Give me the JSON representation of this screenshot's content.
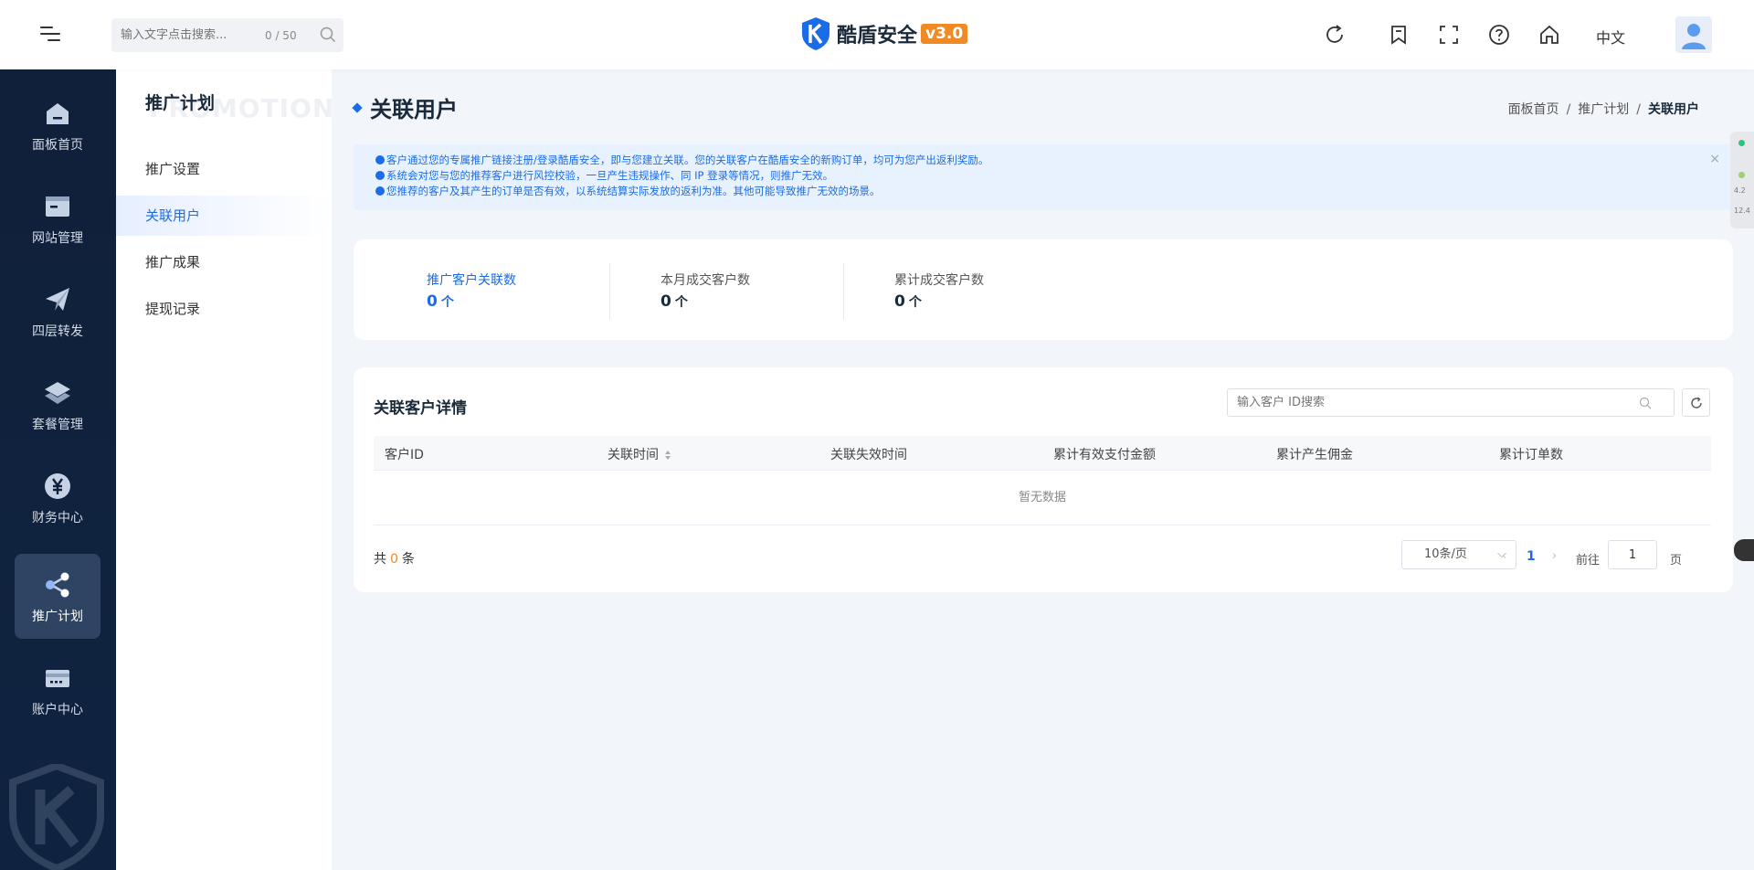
{
  "header": {
    "search_placeholder": "输入文字点击搜索...",
    "search_counter": "0 / 50",
    "brand_name": "酷盾安全",
    "brand_version": "v3.0",
    "language": "中文"
  },
  "sidebar": {
    "items": [
      {
        "label": "面板首页",
        "icon": "house-icon"
      },
      {
        "label": "网站管理",
        "icon": "browser-icon"
      },
      {
        "label": "四层转发",
        "icon": "paper-plane-icon"
      },
      {
        "label": "套餐管理",
        "icon": "layers-icon"
      },
      {
        "label": "财务中心",
        "icon": "yuan-icon"
      },
      {
        "label": "推广计划",
        "icon": "share-icon"
      },
      {
        "label": "账户中心",
        "icon": "wallet-icon"
      }
    ],
    "active_index": 5
  },
  "submenu": {
    "title": "推广计划",
    "watermark": "PROMOTION",
    "items": [
      "推广设置",
      "关联用户",
      "推广成果",
      "提现记录"
    ],
    "active_index": 1
  },
  "page": {
    "title": "关联用户",
    "breadcrumb": [
      "面板首页",
      "推广计划",
      "关联用户"
    ],
    "breadcrumb_sep": "/"
  },
  "alert": {
    "lines": [
      "客户通过您的专属推广链接注册/登录酷盾安全，即与您建立关联。您的关联客户在酷盾安全的新购订单，均可为您产出返利奖励。",
      "系统会对您与您的推荐客户进行风控校验，一旦产生违规操作、同 IP 登录等情况，则推广无效。",
      "您推荐的客户及其产生的订单是否有效，以系统结算实际发放的返利为准。其他可能导致推广无效的场景。"
    ],
    "close_symbol": "×"
  },
  "stats": [
    {
      "label": "推广客户关联数",
      "value": "0",
      "unit": "个"
    },
    {
      "label": "本月成交客户数",
      "value": "0",
      "unit": "个"
    },
    {
      "label": "累计成交客户数",
      "value": "0",
      "unit": "个"
    }
  ],
  "table": {
    "title": "关联客户详情",
    "search_placeholder": "输入客户 ID搜索",
    "columns": [
      "客户ID",
      "关联时间",
      "关联失效时间",
      "累计有效支付金额",
      "累计产生佣金",
      "累计订单数"
    ],
    "empty_text": "暂无数据",
    "total_prefix": "共",
    "total_count": "0",
    "total_suffix": "条",
    "page_size": "10条/页",
    "current_page": "1",
    "goto_label": "前往",
    "goto_value": "1",
    "goto_suffix": "页"
  },
  "right_widget": {
    "text_1": "4.2",
    "text_2": "12.4"
  },
  "colors": {
    "accent": "#1a6ce8",
    "sidebar_bg": "#10203a",
    "version_badge": "#f08a24"
  }
}
